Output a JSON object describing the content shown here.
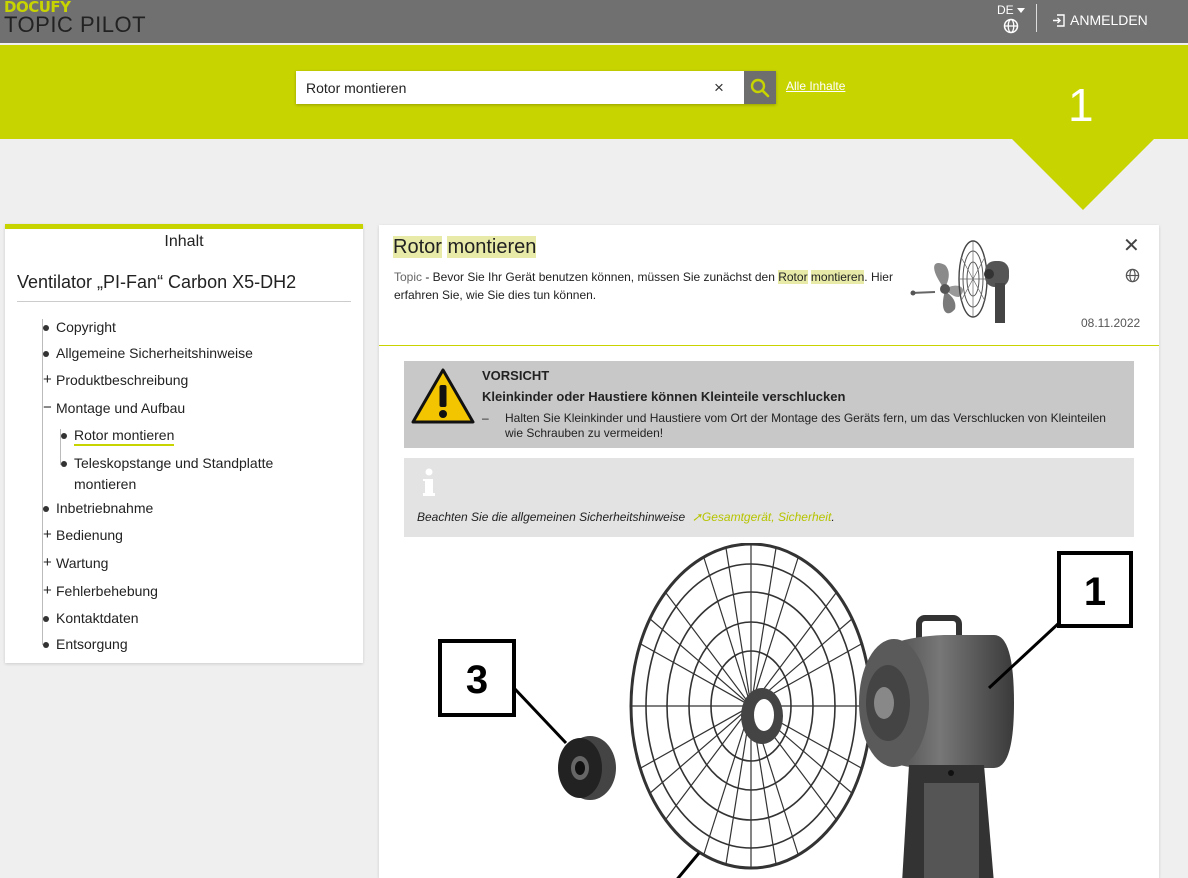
{
  "header": {
    "logo_top": "DOCUFY",
    "logo_bottom": "TOPIC PILOT",
    "language": "DE",
    "login_label": "ANMELDEN"
  },
  "search": {
    "value": "Rotor montieren",
    "clear_icon": "×",
    "all_content_link": "Alle Inhalte"
  },
  "step_number": "1",
  "toc": {
    "heading": "Inhalt",
    "title": "Ventilator „PI-Fan“ Carbon X5-DH2",
    "items": [
      {
        "label": "Copyright",
        "marker": "bullet"
      },
      {
        "label": "Allgemeine Sicherheitshinweise",
        "marker": "bullet"
      },
      {
        "label": "Produktbeschreibung",
        "marker": "+"
      },
      {
        "label": "Montage und Aufbau",
        "marker": "−"
      },
      {
        "label": "Rotor montieren",
        "marker": "bullet",
        "active": true
      },
      {
        "label": "Teleskopstange und Standplatte montieren",
        "marker": "bullet"
      },
      {
        "label": "Inbetriebnahme",
        "marker": "bullet"
      },
      {
        "label": "Bedienung",
        "marker": "+"
      },
      {
        "label": "Wartung",
        "marker": "+"
      },
      {
        "label": "Fehlerbehebung",
        "marker": "+"
      },
      {
        "label": "Kontaktdaten",
        "marker": "bullet"
      },
      {
        "label": "Entsorgung",
        "marker": "bullet"
      }
    ]
  },
  "topic": {
    "title_word1": "Rotor",
    "title_word2": "montieren",
    "type_label": "Topic",
    "desc_pre": " - Bevor Sie Ihr Gerät benutzen können, müssen Sie zunächst den ",
    "desc_hl1": "Rotor",
    "desc_hl2": "montieren",
    "desc_post": ". Hier erfahren Sie, wie Sie dies tun können.",
    "date": "08.11.2022",
    "close_icon": "✕"
  },
  "caution": {
    "signal_word": "VORSICHT",
    "hazard": "Kleinkinder oder Haustiere können Kleinteile verschlucken",
    "dash": "–",
    "measure": "Halten Sie Kleinkinder und Haustiere vom Ort der Montage des Geräts fern, um das Verschlucken von Kleinteilen wie Schrauben zu vermeiden!"
  },
  "info": {
    "text": "Beachten Sie die allgemeinen Sicherheitshinweise",
    "link": "Gesamtgerät, Sicherheit",
    "suffix": "."
  },
  "illustration": {
    "callout_1": "1",
    "callout_3": "3"
  },
  "colors": {
    "brand_yellow": "#c8d400",
    "topbar_gray": "#707070",
    "highlight": "#e8eba8"
  },
  "icons": [
    "globe-icon",
    "login-icon",
    "search-icon",
    "close-icon",
    "warning-icon",
    "info-icon"
  ]
}
